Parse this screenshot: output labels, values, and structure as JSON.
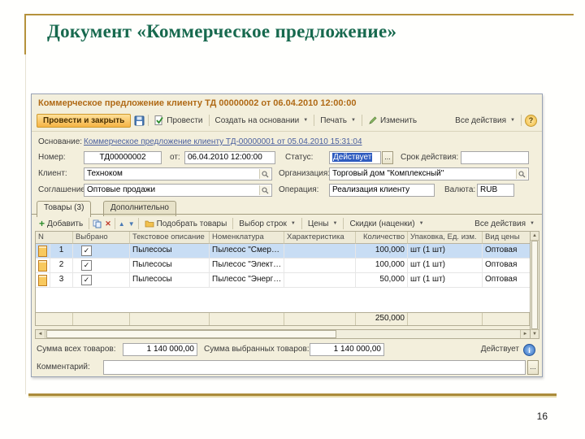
{
  "slide": {
    "title": "Документ «Коммерческое предложение»",
    "page_number": "16",
    "accent_gold": "#b5923c",
    "title_color": "#17694e"
  },
  "icons": {
    "help": "?",
    "info": "i",
    "check": "✓",
    "dots": "...",
    "caret": "▼",
    "up": "▲",
    "down": "▼",
    "left": "◄",
    "right": "►",
    "add": "+",
    "delete": "✕"
  },
  "window": {
    "title": "Коммерческое предложение клиенту ТД 00000002 от 06.04.2010 12:00:00",
    "toolbar": {
      "post_and_close": "Провести и закрыть",
      "post": "Провести",
      "create_on_basis": "Создать на основании",
      "print": "Печать",
      "edit": "Изменить",
      "all_actions": "Все действия"
    },
    "fields": {
      "basis_label": "Основание:",
      "basis_link": "Коммерческое предложение клиенту ТД-00000001 от 05.04.2010 15:31:04",
      "number_label": "Номер:",
      "number_value": "ТД00000002",
      "date_label": "от:",
      "date_value": "06.04.2010 12:00:00",
      "status_label": "Статус:",
      "status_value": "Действует",
      "validity_label": "Срок действия:",
      "client_label": "Клиент:",
      "client_value": "Техноком",
      "org_label": "Организация:",
      "org_value": "Торговый дом \"Комплексный\"",
      "agreement_label": "Соглашение:",
      "agreement_value": "Оптовые продажи",
      "operation_label": "Операция:",
      "operation_value": "Реализация клиенту",
      "currency_label": "Валюта:",
      "currency_value": "RUB"
    },
    "tabs": {
      "goods": "Товары (3)",
      "additional": "Дополнительно"
    },
    "table": {
      "toolbar": {
        "add": "Добавить",
        "pick": "Подобрать товары",
        "row_select": "Выбор строк",
        "prices": "Цены",
        "discounts": "Скидки (наценки)",
        "all_actions": "Все действия"
      },
      "columns": {
        "n": "N",
        "selected": "Выбрано",
        "text_desc": "Текстовое описание",
        "nomenclature": "Номенклатура",
        "characteristic": "Характеристика",
        "quantity": "Количество",
        "package": "Упаковка, Ед. изм.",
        "price_kind": "Вид цены"
      },
      "rows": [
        {
          "n": "1",
          "text_desc": "Пылесосы",
          "nomenclature": "Пылесос \"Смер…",
          "characteristic": "",
          "quantity": "100,000",
          "package": "шт (1 шт)",
          "price_kind": "Оптовая"
        },
        {
          "n": "2",
          "text_desc": "Пылесосы",
          "nomenclature": "Пылесос \"Элект…",
          "characteristic": "",
          "quantity": "100,000",
          "package": "шт (1 шт)",
          "price_kind": "Оптовая"
        },
        {
          "n": "3",
          "text_desc": "Пылесосы",
          "nomenclature": "Пылесос \"Энерг…",
          "characteristic": "",
          "quantity": "50,000",
          "package": "шт (1 шт)",
          "price_kind": "Оптовая"
        }
      ],
      "total_quantity": "250,000"
    },
    "footer": {
      "sum_all_label": "Сумма всех товаров:",
      "sum_all_value": "1 140 000,00",
      "sum_selected_label": "Сумма выбранных товаров:",
      "sum_selected_value": "1 140 000,00",
      "status": "Действует",
      "comment_label": "Комментарий:",
      "comment_value": ""
    }
  }
}
